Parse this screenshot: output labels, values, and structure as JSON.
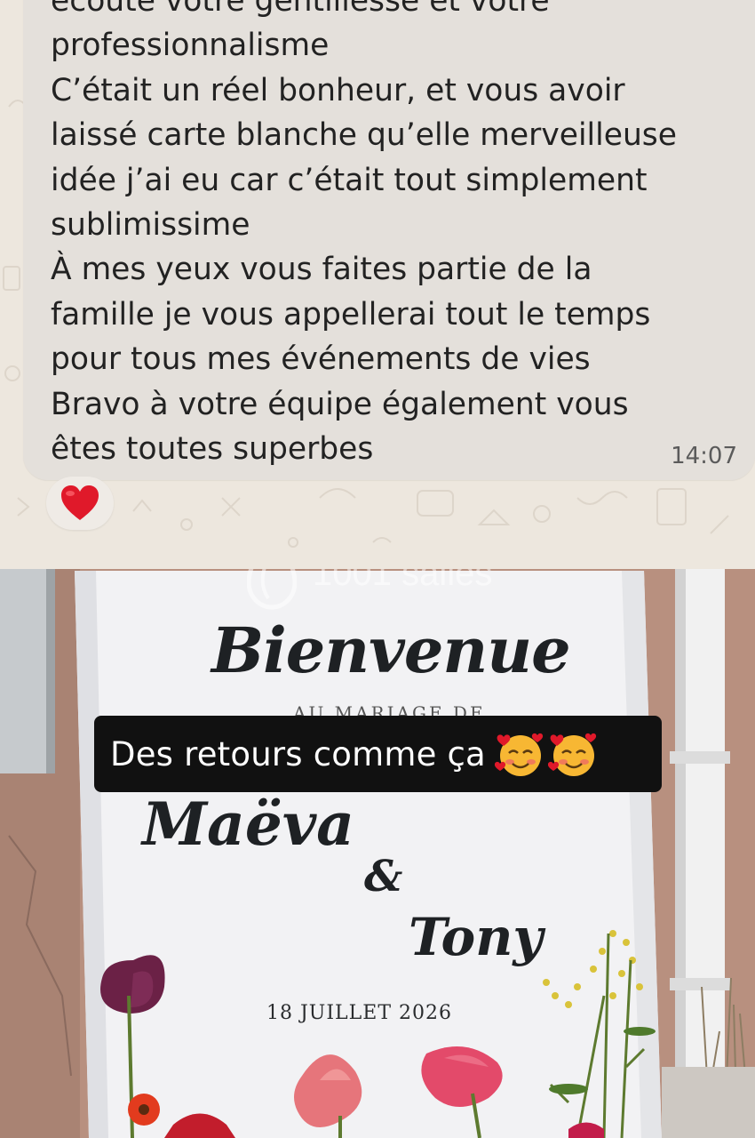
{
  "message": {
    "lines": [
      "écoute votre gentillesse et votre",
      "professionnalisme",
      "C’était un réel bonheur, et vous avoir",
      "laissé carte blanche qu’elle merveilleuse",
      "idée j’ai eu car c’était tout simplement",
      "sublimissime",
      "À mes yeux vous faites partie de la",
      "famille je vous appellerai tout le temps",
      "pour tous mes événements de vies",
      "Bravo à votre équipe également vous",
      "êtes toutes superbes"
    ],
    "time": "14:07",
    "reaction_icon": "red-heart-icon"
  },
  "watermark": "1001 salles",
  "board": {
    "title": "Bienvenue",
    "partial_line": "AU MARIAGE DE",
    "bride": "Maëva",
    "ampersand": "&",
    "groom": "Tony",
    "date": "18 JUILLET 2026"
  },
  "caption": {
    "text": "Des retours comme ça",
    "emoji_icon": "smiling-face-with-hearts-icon"
  },
  "colors": {
    "bubble": "#e4e0db",
    "heart": "#e0192a",
    "caption_bg": "#111111",
    "wall": "#b99486",
    "board": "#f2f2f4"
  }
}
